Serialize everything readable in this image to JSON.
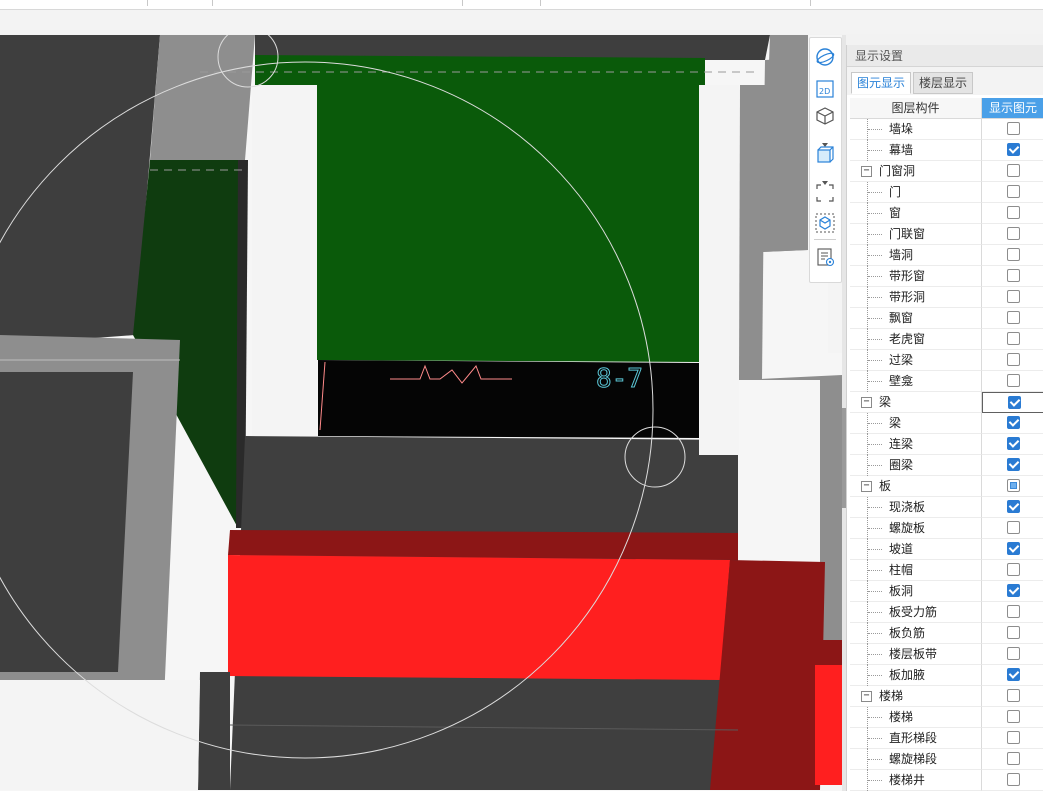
{
  "top_bar": {
    "separators": 5
  },
  "view_tools": [
    {
      "name": "orbit-icon"
    },
    {
      "name": "view-2d-icon",
      "label": "2D"
    },
    {
      "name": "view-3d-icon",
      "caret": true
    },
    {
      "name": "display-mode-icon",
      "caret": true
    },
    {
      "name": "zoom-extents-icon"
    },
    {
      "name": "local-3d-icon"
    },
    {
      "name": "display-settings-icon"
    }
  ],
  "panel": {
    "title": "显示设置",
    "tabs": [
      {
        "label": "图元显示",
        "active": true
      },
      {
        "label": "楼层显示",
        "active": false
      }
    ],
    "header": {
      "col1": "图层构件",
      "col2": "显示图元"
    },
    "rows": [
      {
        "label": "墙垛",
        "type": "child",
        "checked": false
      },
      {
        "label": "幕墙",
        "type": "child",
        "checked": true
      },
      {
        "label": "门窗洞",
        "type": "group",
        "checked": false
      },
      {
        "label": "门",
        "type": "child",
        "checked": false
      },
      {
        "label": "窗",
        "type": "child",
        "checked": false
      },
      {
        "label": "门联窗",
        "type": "child",
        "checked": false
      },
      {
        "label": "墙洞",
        "type": "child",
        "checked": false
      },
      {
        "label": "带形窗",
        "type": "child",
        "checked": false
      },
      {
        "label": "带形洞",
        "type": "child",
        "checked": false
      },
      {
        "label": "飘窗",
        "type": "child",
        "checked": false
      },
      {
        "label": "老虎窗",
        "type": "child",
        "checked": false
      },
      {
        "label": "过梁",
        "type": "child",
        "checked": false
      },
      {
        "label": "壁龛",
        "type": "child",
        "checked": false
      },
      {
        "label": "梁",
        "type": "group",
        "checked": true,
        "selected": true
      },
      {
        "label": "梁",
        "type": "child",
        "checked": true
      },
      {
        "label": "连梁",
        "type": "child",
        "checked": true
      },
      {
        "label": "圈梁",
        "type": "child",
        "checked": true
      },
      {
        "label": "板",
        "type": "group",
        "checked": "partial"
      },
      {
        "label": "现浇板",
        "type": "child",
        "checked": true
      },
      {
        "label": "螺旋板",
        "type": "child",
        "checked": false
      },
      {
        "label": "坡道",
        "type": "child",
        "checked": true
      },
      {
        "label": "柱帽",
        "type": "child",
        "checked": false
      },
      {
        "label": "板洞",
        "type": "child",
        "checked": true
      },
      {
        "label": "板受力筋",
        "type": "child",
        "checked": false
      },
      {
        "label": "板负筋",
        "type": "child",
        "checked": false
      },
      {
        "label": "楼层板带",
        "type": "child",
        "checked": false
      },
      {
        "label": "板加腋",
        "type": "child",
        "checked": true
      },
      {
        "label": "楼梯",
        "type": "group",
        "checked": false
      },
      {
        "label": "楼梯",
        "type": "child",
        "checked": false
      },
      {
        "label": "直形梯段",
        "type": "child",
        "checked": false
      },
      {
        "label": "螺旋梯段",
        "type": "child",
        "checked": false
      },
      {
        "label": "楼梯井",
        "type": "child",
        "checked": false
      }
    ]
  },
  "scene_text": {
    "grid_label": "8-7"
  },
  "colors": {
    "accent": "#2a82d8",
    "header_blue": "#4aa0e8",
    "wall_green": "#0a5a0a",
    "beam_red": "#ff1f1f"
  }
}
